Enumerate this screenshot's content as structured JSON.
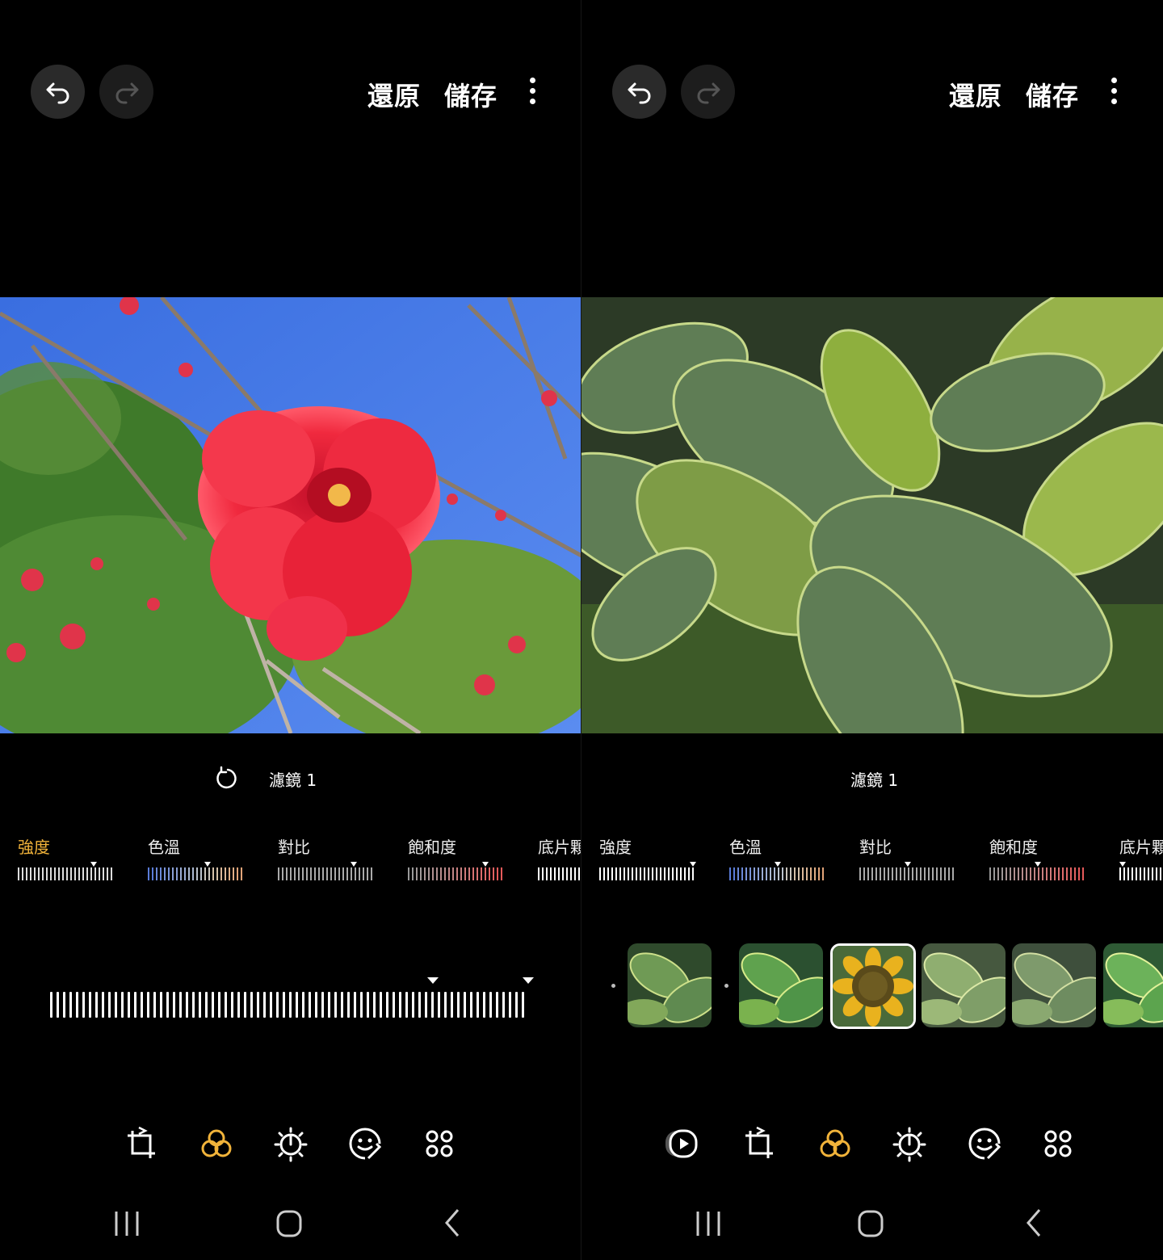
{
  "left": {
    "top_bar": {
      "revert_label": "還原",
      "save_label": "儲存"
    },
    "filter_title": "濾鏡 1",
    "adjustments": [
      {
        "label": "強度",
        "active": true
      },
      {
        "label": "色溫",
        "active": false
      },
      {
        "label": "對比",
        "active": false
      },
      {
        "label": "飽和度",
        "active": false
      },
      {
        "label": "底片顆",
        "active": false
      }
    ],
    "intensity_level": 0.8
  },
  "right": {
    "top_bar": {
      "revert_label": "還原",
      "save_label": "儲存"
    },
    "filter_title": "濾鏡 1",
    "adjustments": [
      {
        "label": "強度",
        "active": false
      },
      {
        "label": "色溫",
        "active": false
      },
      {
        "label": "對比",
        "active": false
      },
      {
        "label": "飽和度",
        "active": false
      },
      {
        "label": "底片顆",
        "active": false
      }
    ],
    "filter_thumbnails": [
      "leaves-original",
      "leaves-vivid",
      "sunflower-custom",
      "leaves-soft",
      "leaves-muted",
      "leaves-bright"
    ],
    "selected_thumbnail": 2
  },
  "colors": {
    "accent": "#f1b33a",
    "background": "#000000"
  },
  "icons": {
    "undo": "undo-icon",
    "redo": "redo-icon",
    "more": "more-vert-icon",
    "reset": "reset-icon",
    "crop": "crop-rotate-icon",
    "filter": "filter-icon",
    "tone": "brightness-icon",
    "decorate": "sticker-icon",
    "more_tools": "more-tools-icon",
    "video": "video-icon"
  }
}
